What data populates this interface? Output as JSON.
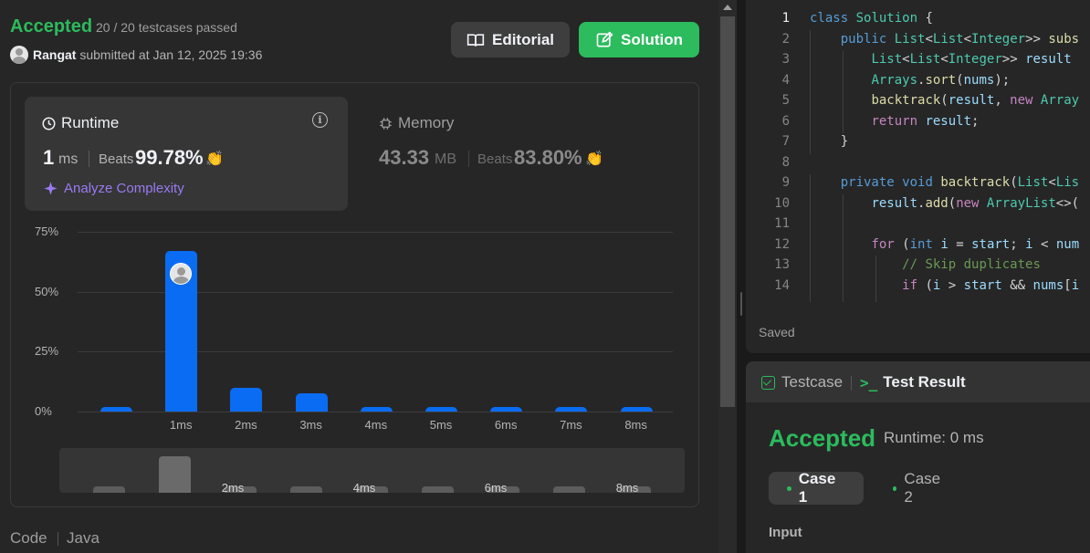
{
  "submission": {
    "status": "Accepted",
    "testcases": "20 / 20 testcases passed",
    "user": "Rangat",
    "submitted_text": "submitted at Jan 12, 2025 19:36",
    "editorial_label": "Editorial",
    "solution_label": "Solution"
  },
  "runtime": {
    "label": "Runtime",
    "value": "1",
    "unit": "ms",
    "beats_label": "Beats",
    "beats_value": "99.78%",
    "analyze_label": "Analyze Complexity"
  },
  "memory": {
    "label": "Memory",
    "value": "43.33",
    "unit": "MB",
    "beats_label": "Beats",
    "beats_value": "83.80%"
  },
  "chart_data": {
    "type": "bar",
    "categories": [
      "",
      "1ms",
      "2ms",
      "3ms",
      "4ms",
      "5ms",
      "6ms",
      "7ms",
      "8ms"
    ],
    "values": [
      2,
      67,
      10,
      7.5,
      2,
      2,
      2,
      2,
      2
    ],
    "yticks": [
      "75%",
      "50%",
      "25%",
      "0%"
    ],
    "ylim": [
      0,
      75
    ],
    "mini_ticks": [
      "2ms",
      "4ms",
      "6ms",
      "8ms"
    ],
    "highlight_index": 1
  },
  "code_tab": {
    "label": "Code",
    "lang": "Java"
  },
  "editor": {
    "line_numbers": [
      "1",
      "2",
      "3",
      "4",
      "5",
      "6",
      "7",
      "8",
      "9",
      "10",
      "11",
      "12",
      "13",
      "14"
    ],
    "saved_label": "Saved"
  },
  "result_panel": {
    "tab_testcase": "Testcase",
    "tab_result": "Test Result",
    "status": "Accepted",
    "runtime_text": "Runtime: 0 ms",
    "case1": "Case 1",
    "case2": "Case 2",
    "input_label": "Input"
  },
  "colors": {
    "accent_green": "#2cbb5d",
    "bar_blue": "#0a6cf2",
    "analyze_purple": "#9a7af1"
  }
}
